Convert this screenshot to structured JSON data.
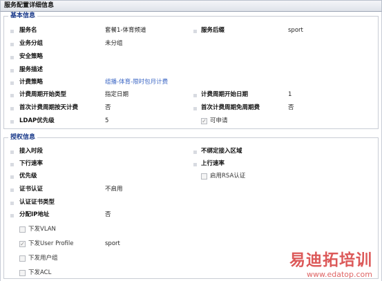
{
  "window": {
    "title": "服务配置详细信息"
  },
  "basic": {
    "legend": "基本信息",
    "service_name_label": "服务名",
    "service_name_value": "套餐1-体育频道",
    "service_suffix_label": "服务后缀",
    "service_suffix_value": "sport",
    "business_group_label": "业务分组",
    "business_group_value": "未分组",
    "security_policy_label": "安全策略",
    "service_desc_label": "服务描述",
    "billing_policy_label": "计费策略",
    "billing_policy_value": "组播-体育-限时包月计费",
    "cycle_start_type_label": "计费周期开始类型",
    "cycle_start_type_value": "指定日期",
    "cycle_start_date_label": "计费周期开始日期",
    "cycle_start_date_value": "1",
    "first_daily_label": "首次计费周期按天计费",
    "first_daily_value": "否",
    "first_free_label": "首次计费周期免周期费",
    "first_free_value": "否",
    "ldap_label": "LDAP优先级",
    "ldap_value": "5",
    "applicable_label": "可申请",
    "applicable_checked": true
  },
  "auth": {
    "legend": "授权信息",
    "access_period_label": "接入时段",
    "no_bind_area_label": "不绑定接入区域",
    "downlink_label": "下行速率",
    "uplink_label": "上行速率",
    "priority_label": "优先级",
    "rsa_label": "启用RSA认证",
    "rsa_checked": false,
    "cert_auth_label": "证书认证",
    "cert_auth_value": "不启用",
    "cert_type_label": "认证证书类型",
    "assign_ip_label": "分配IP地址",
    "assign_ip_value": "否",
    "vlan_label": "下发VLAN",
    "vlan_checked": false,
    "user_profile_label": "下发User Profile",
    "user_profile_checked": true,
    "user_profile_value": "sport",
    "user_group_label": "下发用户组",
    "user_group_checked": false,
    "acl_label": "下发ACL",
    "acl_checked": false
  },
  "watermark": {
    "text": "易迪拓培训",
    "url": "www.edatop.com"
  }
}
